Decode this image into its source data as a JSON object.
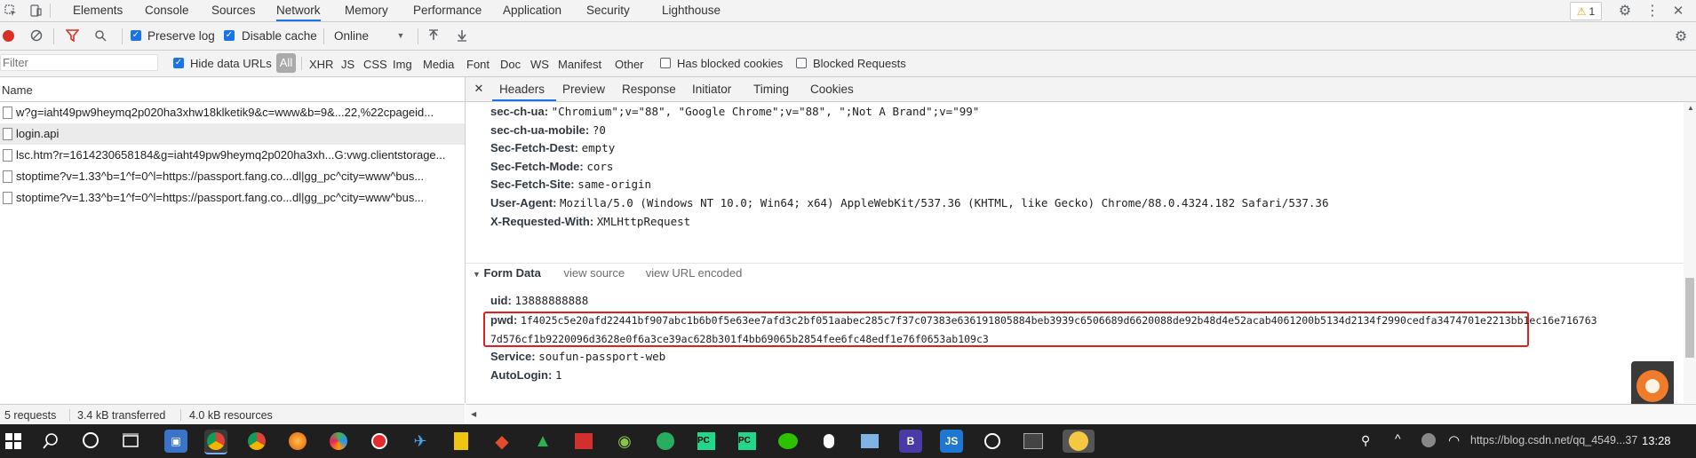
{
  "devtools": {
    "tabs": [
      "Elements",
      "Console",
      "Sources",
      "Network",
      "Memory",
      "Performance",
      "Application",
      "Security",
      "Lighthouse"
    ],
    "active_tab": "Network",
    "warning_count": "1"
  },
  "toolbar": {
    "preserve_log": "Preserve log",
    "disable_cache": "Disable cache",
    "throttle": "Online"
  },
  "filterbar": {
    "filter_placeholder": "Filter",
    "hide_data_urls": "Hide data URLs",
    "all": "All",
    "types": [
      "XHR",
      "JS",
      "CSS",
      "Img",
      "Media",
      "Font",
      "Doc",
      "WS",
      "Manifest",
      "Other"
    ],
    "has_blocked_cookies": "Has blocked cookies",
    "blocked_requests": "Blocked Requests"
  },
  "requests": {
    "column_name": "Name",
    "items": [
      "w?g=iaht49pw9heymq2p020ha3xhw18klketik9&c=www&b=9&...22,%22cpageid...",
      "login.api",
      "lsc.htm?r=1614230658184&g=iaht49pw9heymq2p020ha3xh...G:vwg.clientstorage...",
      "stoptime?v=1.33^b=1^f=0^l=https://passport.fang.co...dl|gg_pc^city=www^bus...",
      "stoptime?v=1.33^b=1^f=0^l=https://passport.fang.co...dl|gg_pc^city=www^bus..."
    ]
  },
  "detail": {
    "tabs": [
      "Headers",
      "Preview",
      "Response",
      "Initiator",
      "Timing",
      "Cookies"
    ],
    "headers": [
      {
        "key": "sec-ch-ua:",
        "value": "\"Chromium\";v=\"88\", \"Google Chrome\";v=\"88\", \";Not A Brand\";v=\"99\""
      },
      {
        "key": "sec-ch-ua-mobile:",
        "value": "?0"
      },
      {
        "key": "Sec-Fetch-Dest:",
        "value": "empty"
      },
      {
        "key": "Sec-Fetch-Mode:",
        "value": "cors"
      },
      {
        "key": "Sec-Fetch-Site:",
        "value": "same-origin"
      },
      {
        "key": "User-Agent:",
        "value": "Mozilla/5.0 (Windows NT 10.0; Win64; x64) AppleWebKit/537.36 (KHTML, like Gecko) Chrome/88.0.4324.182 Safari/537.36"
      },
      {
        "key": "X-Requested-With:",
        "value": "XMLHttpRequest"
      }
    ],
    "form_data": {
      "title": "Form Data",
      "view_source": "view source",
      "view_url_encoded": "view URL encoded",
      "uid_key": "uid:",
      "uid_value": "13888888888",
      "pwd_key": "pwd:",
      "pwd_value_1": "1f4025c5e20afd22441bf907abc1b6b0f5e63ee7afd3c2bf051aabec285c7f37c07383e636191805884beb3939c6506689d6620088de92b48d4e52acab4061200b5134d2134f2990cedfa3474701e2213bb1ec16e716763",
      "pwd_value_2": "7d576cf1b9220096d3628e0f6a3ce39ac628b301f4bb69065b2854fee6fc48edf1e76f0653ab109c3",
      "service_key": "Service:",
      "service_value": "soufun-passport-web",
      "autologin_key": "AutoLogin:",
      "autologin_value": "1"
    }
  },
  "status": {
    "requests": "5 requests",
    "transferred": "3.4 kB transferred",
    "resources": "4.0 kB resources"
  },
  "taskbar": {
    "clock": "13:28",
    "url_fragment": "https://blog.csdn.net/qq_4549...37"
  },
  "colors": {
    "accent": "#1a73e8",
    "highlight_box": "#e02020",
    "record": "#d93025"
  }
}
